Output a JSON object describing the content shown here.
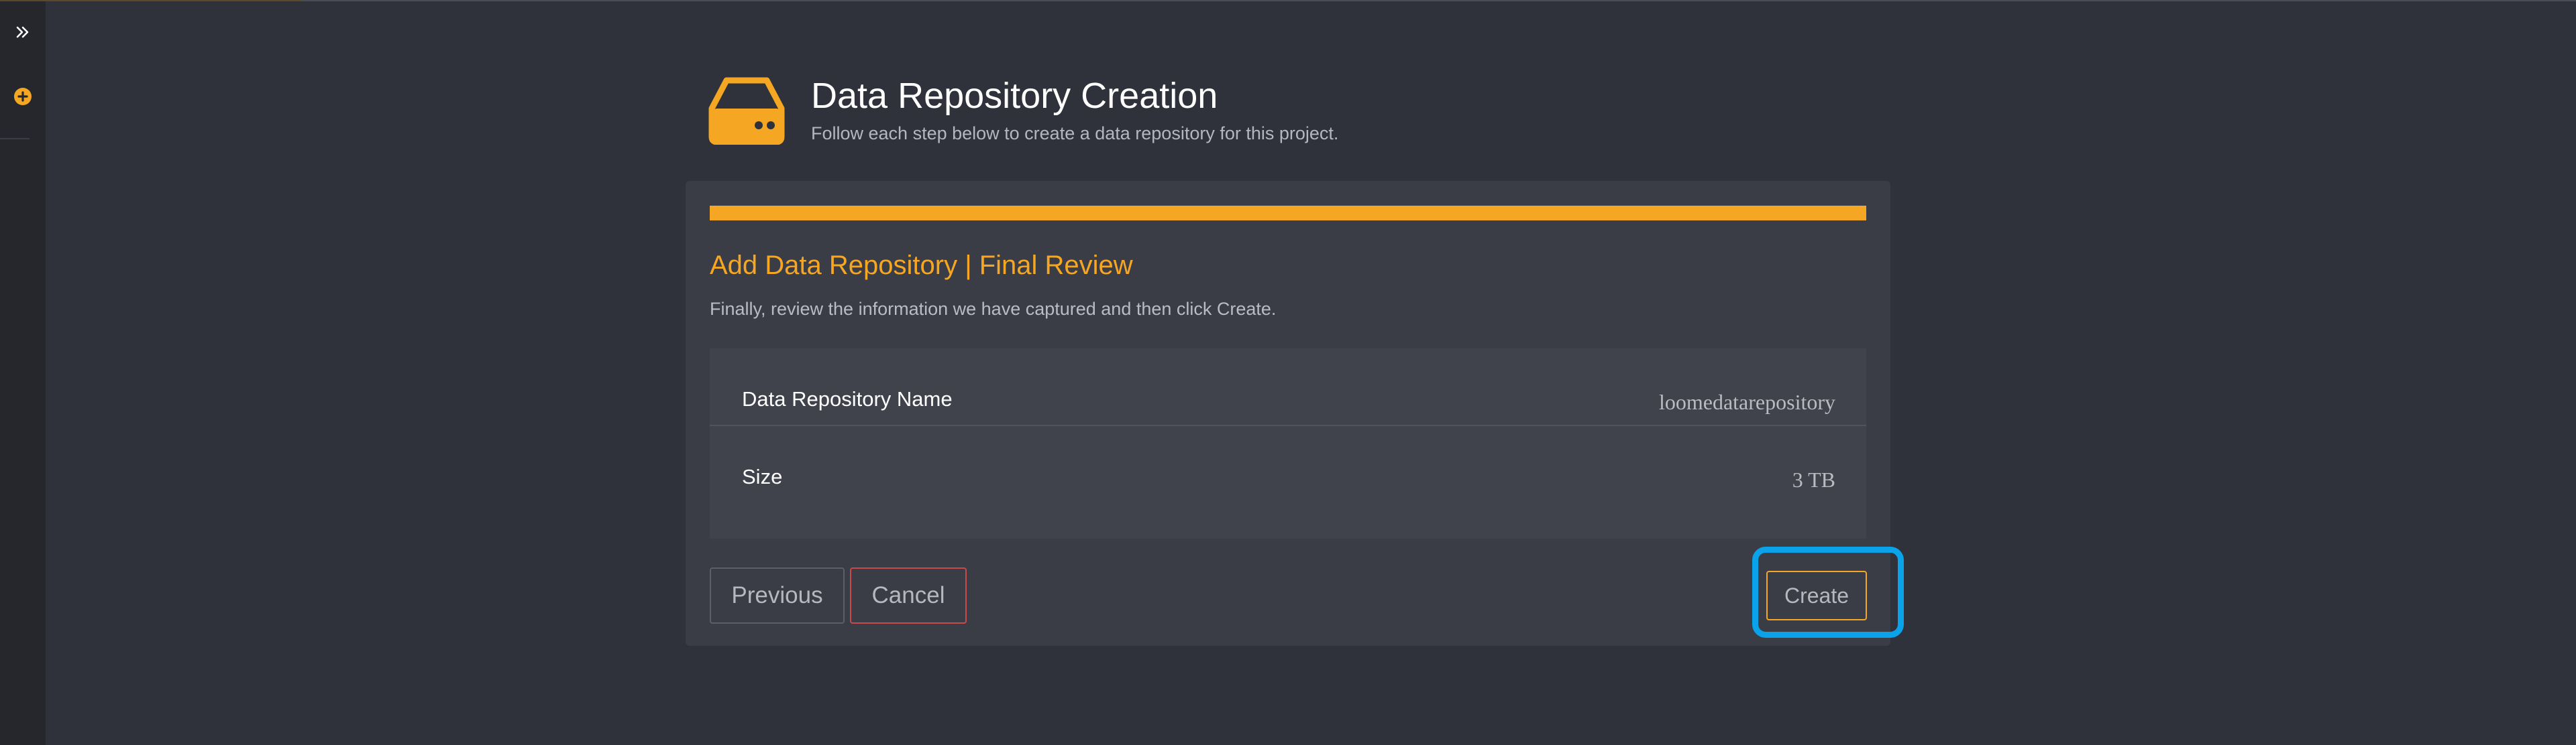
{
  "sidebar": {
    "expand_icon": "double-chevron-right-icon",
    "add_icon": "plus-circle-icon"
  },
  "header": {
    "icon": "hard-drive-icon",
    "title": "Data Repository Creation",
    "subtitle": "Follow each step below to create a data repository for this project."
  },
  "wizard": {
    "progress": 1.0,
    "step_title": "Add Data Repository | Final Review",
    "step_description": "Finally, review the information we have captured and then click Create.",
    "summary": [
      {
        "label": "Data Repository Name",
        "value": "loomedatarepository"
      },
      {
        "label": "Size",
        "value": "3 TB"
      }
    ],
    "buttons": {
      "previous": "Previous",
      "cancel": "Cancel",
      "create": "Create"
    }
  },
  "colors": {
    "accent": "#f5a623",
    "background": "#2f323b",
    "card": "#3b3d46",
    "focus": "#0aa2e8",
    "danger": "#c94a4a"
  }
}
